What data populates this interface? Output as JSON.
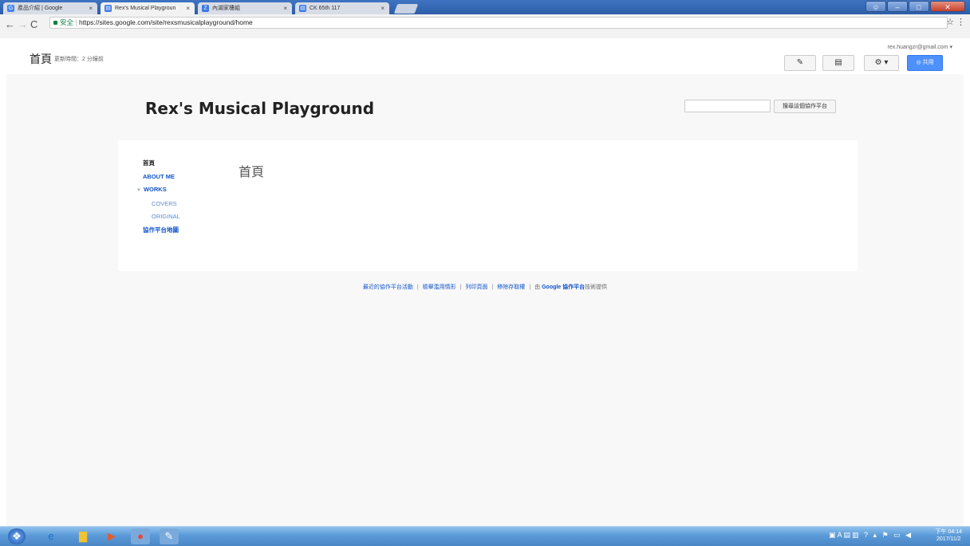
{
  "browser": {
    "tabs": [
      {
        "title": "產品介紹 | Google",
        "favicon": "G",
        "favicon_color": "#4285f4"
      },
      {
        "title": "Rex's Musical Playgroun",
        "favicon": "▤",
        "favicon_color": "#3b78e7"
      },
      {
        "title": "內湖家樓組",
        "favicon": "Z",
        "favicon_color": "#3b78e7"
      },
      {
        "title": "CK 65th 117",
        "favicon": "▤",
        "favicon_color": "#3b78e7"
      }
    ],
    "tab_close": "×",
    "security_label": "安全",
    "url": "https://sites.google.com/site/rexsmusicalplayground/home"
  },
  "header": {
    "page_title": "首頁",
    "updated": "更新時間：2 分鐘前",
    "account": "rex.huangzr@gmail.com ▾",
    "share_label": "共用"
  },
  "site": {
    "title": "Rex's Musical Playground",
    "search_button": "搜尋這個協作平台",
    "nav": {
      "home": "首頁",
      "about": "ABOUT ME",
      "works": "WORKS",
      "covers": "COVERS",
      "original": "ORIGINAL",
      "sitemap": "協作平台地圖"
    },
    "main_heading": "首頁"
  },
  "footer": {
    "recent": "最近的協作平台活動",
    "terms": "檢舉濫用情形",
    "print": "列印頁面",
    "remove": "移除存取權",
    "powered_prefix": "由",
    "powered_brand": "Google 協作平台",
    "powered_suffix": "技術提供"
  },
  "taskbar": {
    "clock_time": "下午 04:14",
    "clock_date": "2017/11/2"
  },
  "colors": {
    "link": "#1155cc",
    "share": "#4d90fe",
    "taskbar": "#5b9ad8"
  }
}
